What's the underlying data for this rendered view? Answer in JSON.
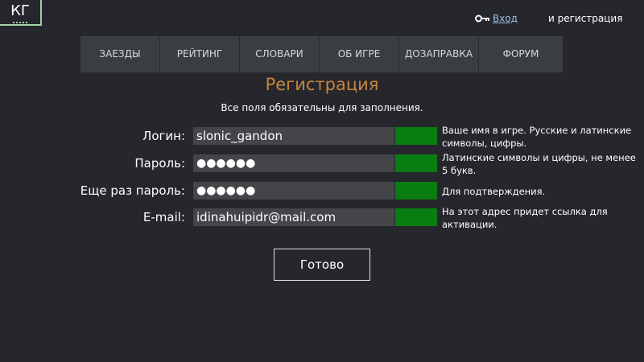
{
  "logo": {
    "text": "КГ"
  },
  "auth": {
    "login_label": "Вход",
    "register_label": "и регистрация"
  },
  "nav": {
    "items": [
      {
        "label": "ЗАЕЗДЫ"
      },
      {
        "label": "РЕЙТИНГ"
      },
      {
        "label": "СЛОВАРИ"
      },
      {
        "label": "ОБ ИГРЕ"
      },
      {
        "label": "ДОЗАПРАВКА"
      },
      {
        "label": "ФОРУМ"
      }
    ]
  },
  "page": {
    "title": "Регистрация",
    "subtitle": "Все поля обязательны для заполнения."
  },
  "form": {
    "login": {
      "label": "Логин:",
      "value": "slonic_gandon",
      "hint": "Ваше имя в игре. Русские и латинские символы, цифры."
    },
    "password": {
      "label": "Пароль:",
      "value": "●●●●●●",
      "hint": "Латинские символы и цифры, не менее 5 букв."
    },
    "password_repeat": {
      "label": "Еще раз пароль:",
      "value": "●●●●●●",
      "hint": "Для подтверждения."
    },
    "email": {
      "label": "E-mail:",
      "value": "idinahuipidr@mail.com",
      "hint": "На этот адрес придет ссылка для активации."
    },
    "submit_label": "Готово"
  },
  "colors": {
    "background": "#25272c",
    "nav_bg": "#3a3d42",
    "title": "#c9843e",
    "status_ok": "#0a7d12",
    "link": "#9fbfe6",
    "logo_border": "#9fd4a4"
  }
}
